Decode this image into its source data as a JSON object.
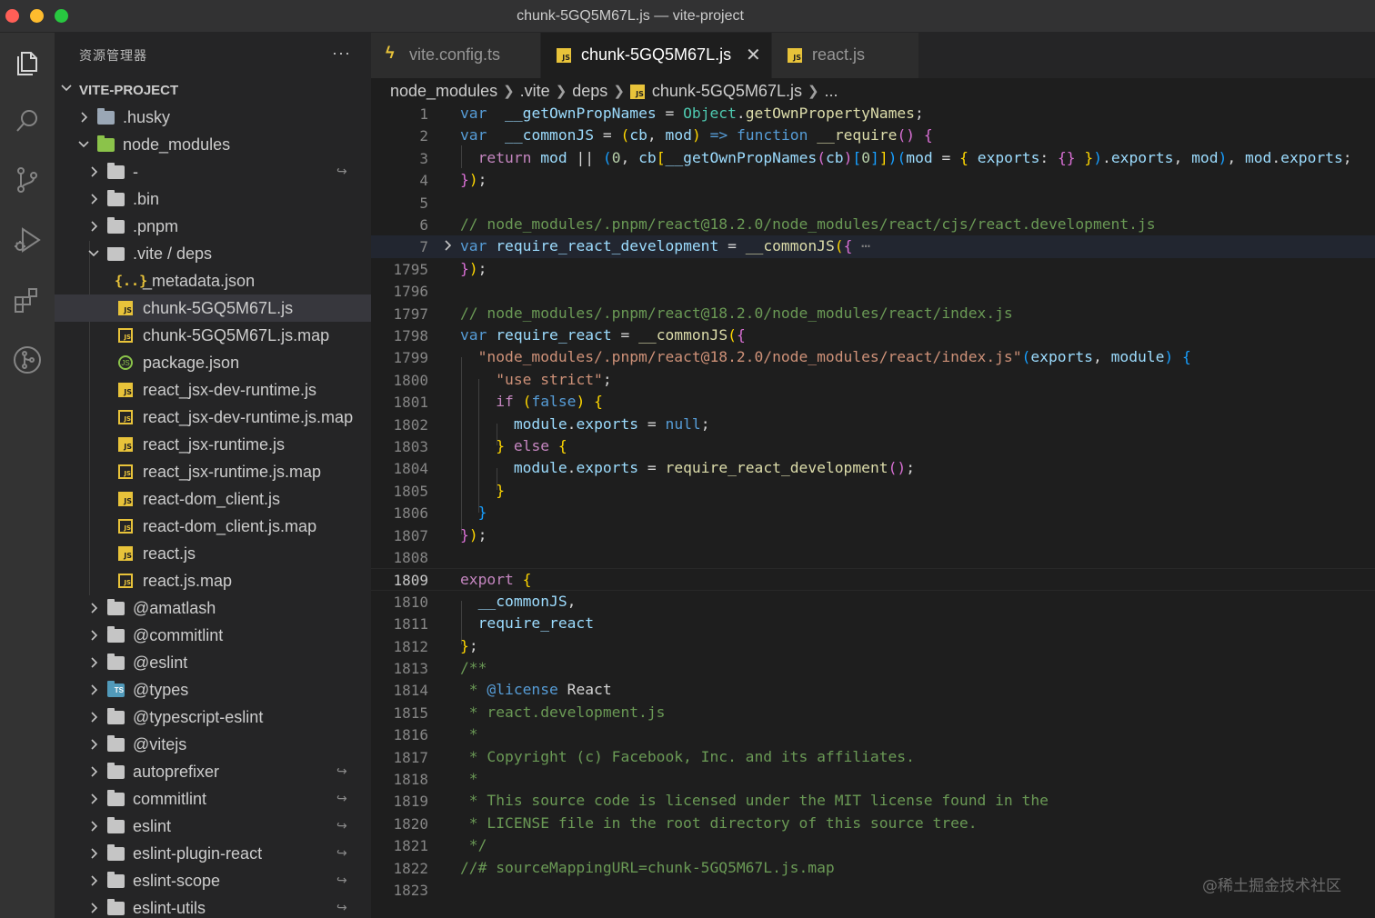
{
  "window": {
    "title": "chunk-5GQ5M67L.js — vite-project"
  },
  "activity_bar": [
    "files-icon",
    "search-icon",
    "source-control-icon",
    "run-debug-icon",
    "extensions-icon",
    "git-graph-icon"
  ],
  "sidebar": {
    "header": "资源管理器",
    "more": "···",
    "project": "VITE-PROJECT",
    "items": [
      {
        "name": ".husky",
        "depth": 1,
        "type": "folder-husky",
        "chevron": "right"
      },
      {
        "name": "node_modules",
        "depth": 1,
        "type": "folder-green",
        "chevron": "down"
      },
      {
        "name": "-",
        "depth": 2,
        "type": "folder",
        "chevron": "right",
        "link": true
      },
      {
        "name": ".bin",
        "depth": 2,
        "type": "folder",
        "chevron": "right"
      },
      {
        "name": ".pnpm",
        "depth": 2,
        "type": "folder",
        "chevron": "right"
      },
      {
        "name": ".vite / deps",
        "depth": 2,
        "type": "folder-open",
        "chevron": "down"
      },
      {
        "name": "_metadata.json",
        "depth": 3,
        "type": "json"
      },
      {
        "name": "chunk-5GQ5M67L.js",
        "depth": 3,
        "type": "js",
        "selected": true
      },
      {
        "name": "chunk-5GQ5M67L.js.map",
        "depth": 3,
        "type": "map"
      },
      {
        "name": "package.json",
        "depth": 3,
        "type": "pkg"
      },
      {
        "name": "react_jsx-dev-runtime.js",
        "depth": 3,
        "type": "js"
      },
      {
        "name": "react_jsx-dev-runtime.js.map",
        "depth": 3,
        "type": "map"
      },
      {
        "name": "react_jsx-runtime.js",
        "depth": 3,
        "type": "js"
      },
      {
        "name": "react_jsx-runtime.js.map",
        "depth": 3,
        "type": "map"
      },
      {
        "name": "react-dom_client.js",
        "depth": 3,
        "type": "js"
      },
      {
        "name": "react-dom_client.js.map",
        "depth": 3,
        "type": "map"
      },
      {
        "name": "react.js",
        "depth": 3,
        "type": "js"
      },
      {
        "name": "react.js.map",
        "depth": 3,
        "type": "map"
      },
      {
        "name": "@amatlash",
        "depth": 2,
        "type": "folder",
        "chevron": "right"
      },
      {
        "name": "@commitlint",
        "depth": 2,
        "type": "folder",
        "chevron": "right"
      },
      {
        "name": "@eslint",
        "depth": 2,
        "type": "folder",
        "chevron": "right"
      },
      {
        "name": "@types",
        "depth": 2,
        "type": "folder-ts",
        "chevron": "right"
      },
      {
        "name": "@typescript-eslint",
        "depth": 2,
        "type": "folder",
        "chevron": "right"
      },
      {
        "name": "@vitejs",
        "depth": 2,
        "type": "folder",
        "chevron": "right"
      },
      {
        "name": "autoprefixer",
        "depth": 2,
        "type": "folder",
        "chevron": "right",
        "link": true
      },
      {
        "name": "commitlint",
        "depth": 2,
        "type": "folder",
        "chevron": "right",
        "link": true
      },
      {
        "name": "eslint",
        "depth": 2,
        "type": "folder",
        "chevron": "right",
        "link": true
      },
      {
        "name": "eslint-plugin-react",
        "depth": 2,
        "type": "folder",
        "chevron": "right",
        "link": true
      },
      {
        "name": "eslint-scope",
        "depth": 2,
        "type": "folder",
        "chevron": "right",
        "link": true
      },
      {
        "name": "eslint-utils",
        "depth": 2,
        "type": "folder",
        "chevron": "right",
        "link": true
      }
    ],
    "link_glyph": "↪"
  },
  "tabs": [
    {
      "label": "vite.config.ts",
      "icon": "bolt-icon",
      "active": false
    },
    {
      "label": "chunk-5GQ5M67L.js",
      "icon": "js-file-icon",
      "active": true,
      "close": "✕"
    },
    {
      "label": "react.js",
      "icon": "js-file-icon",
      "active": false
    }
  ],
  "breadcrumb": [
    "node_modules",
    ".vite",
    "deps",
    "chunk-5GQ5M67L.js",
    "..."
  ],
  "editor": {
    "current_line": "1809",
    "lines": [
      {
        "n": "1",
        "segs": [
          [
            "kw",
            "var"
          ],
          [
            "",
            "  "
          ],
          [
            "var",
            "__getOwnPropNames"
          ],
          [
            "",
            " = "
          ],
          [
            "cls",
            "Object"
          ],
          [
            "",
            "."
          ],
          [
            "fn",
            "getOwnPropertyNames"
          ],
          [
            "",
            ";"
          ]
        ]
      },
      {
        "n": "2",
        "segs": [
          [
            "kw",
            "var"
          ],
          [
            "",
            "  "
          ],
          [
            "var",
            "__commonJS"
          ],
          [
            "",
            " = "
          ],
          [
            "b1",
            "("
          ],
          [
            "var",
            "cb"
          ],
          [
            "",
            ", "
          ],
          [
            "var",
            "mod"
          ],
          [
            "b1",
            ")"
          ],
          [
            "",
            " "
          ],
          [
            "kw",
            "=>"
          ],
          [
            "",
            " "
          ],
          [
            "kw",
            "function"
          ],
          [
            "",
            " "
          ],
          [
            "fn",
            "__require"
          ],
          [
            "b2",
            "()"
          ],
          [
            "",
            " "
          ],
          [
            "b2",
            "{"
          ]
        ]
      },
      {
        "n": "3",
        "segs": [
          [
            "",
            "  "
          ],
          [
            "kw2",
            "return"
          ],
          [
            "",
            " "
          ],
          [
            "var",
            "mod"
          ],
          [
            "",
            " || "
          ],
          [
            "b3",
            "("
          ],
          [
            "num",
            "0"
          ],
          [
            "",
            ", "
          ],
          [
            "var",
            "cb"
          ],
          [
            "b1",
            "["
          ],
          [
            "var",
            "__getOwnPropNames"
          ],
          [
            "b2",
            "("
          ],
          [
            "var",
            "cb"
          ],
          [
            "b2",
            ")"
          ],
          [
            "b3",
            "["
          ],
          [
            "num",
            "0"
          ],
          [
            "b3",
            "]"
          ],
          [
            "b1",
            "]"
          ],
          [
            "b3",
            ")"
          ],
          [
            "b3",
            "("
          ],
          [
            "var",
            "mod"
          ],
          [
            "",
            " = "
          ],
          [
            "b1",
            "{"
          ],
          [
            "",
            " "
          ],
          [
            "var",
            "exports"
          ],
          [
            "",
            ": "
          ],
          [
            "b2",
            "{}"
          ],
          [
            "",
            " "
          ],
          [
            "b1",
            "}"
          ],
          [
            "b3",
            ")"
          ],
          [
            "",
            "."
          ],
          [
            "var",
            "exports"
          ],
          [
            "",
            ", "
          ],
          [
            "var",
            "mod"
          ],
          [
            "b3",
            ")"
          ],
          [
            "",
            ", "
          ],
          [
            "var",
            "mod"
          ],
          [
            "",
            "."
          ],
          [
            "var",
            "exports"
          ],
          [
            "",
            ";"
          ]
        ]
      },
      {
        "n": "4",
        "segs": [
          [
            "b2",
            "}"
          ],
          [
            "b1",
            ")"
          ],
          [
            "",
            ";"
          ]
        ]
      },
      {
        "n": "5",
        "segs": []
      },
      {
        "n": "6",
        "segs": [
          [
            "cm",
            "// node_modules/.pnpm/react@18.2.0/node_modules/react/cjs/react.development.js"
          ]
        ]
      },
      {
        "n": "7",
        "fold": true,
        "hl": true,
        "segs": [
          [
            "kw",
            "var"
          ],
          [
            "",
            " "
          ],
          [
            "var",
            "require_react_development"
          ],
          [
            "",
            " = "
          ],
          [
            "fn",
            "__commonJS"
          ],
          [
            "b1",
            "("
          ],
          [
            "b2",
            "{"
          ],
          [
            "dim",
            " ⋯"
          ]
        ]
      },
      {
        "n": "1795",
        "segs": [
          [
            "b2",
            "}"
          ],
          [
            "b1",
            ")"
          ],
          [
            "",
            ";"
          ]
        ]
      },
      {
        "n": "1796",
        "segs": []
      },
      {
        "n": "1797",
        "segs": [
          [
            "cm",
            "// node_modules/.pnpm/react@18.2.0/node_modules/react/index.js"
          ]
        ]
      },
      {
        "n": "1798",
        "segs": [
          [
            "kw",
            "var"
          ],
          [
            "",
            " "
          ],
          [
            "var",
            "require_react"
          ],
          [
            "",
            " = "
          ],
          [
            "fn",
            "__commonJS"
          ],
          [
            "b1",
            "("
          ],
          [
            "b2",
            "{"
          ]
        ]
      },
      {
        "n": "1799",
        "segs": [
          [
            "",
            "  "
          ],
          [
            "str",
            "\"node_modules/.pnpm/react@18.2.0/node_modules/react/index.js\""
          ],
          [
            "b3",
            "("
          ],
          [
            "var",
            "exports"
          ],
          [
            "",
            ", "
          ],
          [
            "var",
            "module"
          ],
          [
            "b3",
            ")"
          ],
          [
            "",
            " "
          ],
          [
            "b3",
            "{"
          ]
        ]
      },
      {
        "n": "1800",
        "segs": [
          [
            "",
            "    "
          ],
          [
            "str",
            "\"use strict\""
          ],
          [
            "",
            ";"
          ]
        ]
      },
      {
        "n": "1801",
        "segs": [
          [
            "",
            "    "
          ],
          [
            "kw2",
            "if"
          ],
          [
            "",
            " "
          ],
          [
            "b1",
            "("
          ],
          [
            "kw",
            "false"
          ],
          [
            "b1",
            ")"
          ],
          [
            "",
            " "
          ],
          [
            "b1",
            "{"
          ]
        ]
      },
      {
        "n": "1802",
        "segs": [
          [
            "",
            "      "
          ],
          [
            "var",
            "module"
          ],
          [
            "",
            "."
          ],
          [
            "var",
            "exports"
          ],
          [
            "",
            " = "
          ],
          [
            "kw",
            "null"
          ],
          [
            "",
            ";"
          ]
        ]
      },
      {
        "n": "1803",
        "segs": [
          [
            "",
            "    "
          ],
          [
            "b1",
            "}"
          ],
          [
            "",
            " "
          ],
          [
            "kw2",
            "else"
          ],
          [
            "",
            " "
          ],
          [
            "b1",
            "{"
          ]
        ]
      },
      {
        "n": "1804",
        "segs": [
          [
            "",
            "      "
          ],
          [
            "var",
            "module"
          ],
          [
            "",
            "."
          ],
          [
            "var",
            "exports"
          ],
          [
            "",
            " = "
          ],
          [
            "fn",
            "require_react_development"
          ],
          [
            "b2",
            "()"
          ],
          [
            "",
            ";"
          ]
        ]
      },
      {
        "n": "1805",
        "segs": [
          [
            "",
            "    "
          ],
          [
            "b1",
            "}"
          ]
        ]
      },
      {
        "n": "1806",
        "segs": [
          [
            "",
            "  "
          ],
          [
            "b3",
            "}"
          ]
        ]
      },
      {
        "n": "1807",
        "segs": [
          [
            "b2",
            "}"
          ],
          [
            "b1",
            ")"
          ],
          [
            "",
            ";"
          ]
        ]
      },
      {
        "n": "1808",
        "segs": []
      },
      {
        "n": "1809",
        "segs": [
          [
            "kw2",
            "export"
          ],
          [
            "",
            " "
          ],
          [
            "b1",
            "{"
          ]
        ]
      },
      {
        "n": "1810",
        "segs": [
          [
            "",
            "  "
          ],
          [
            "var",
            "__commonJS"
          ],
          [
            "",
            ","
          ]
        ]
      },
      {
        "n": "1811",
        "segs": [
          [
            "",
            "  "
          ],
          [
            "var",
            "require_react"
          ]
        ]
      },
      {
        "n": "1812",
        "segs": [
          [
            "b1",
            "}"
          ],
          [
            "",
            ";"
          ]
        ]
      },
      {
        "n": "1813",
        "segs": [
          [
            "cm",
            "/**"
          ]
        ]
      },
      {
        "n": "1814",
        "segs": [
          [
            "cm",
            " * "
          ],
          [
            "kw",
            "@license"
          ],
          [
            "",
            " React"
          ]
        ]
      },
      {
        "n": "1815",
        "segs": [
          [
            "cm",
            " * react.development.js"
          ]
        ]
      },
      {
        "n": "1816",
        "segs": [
          [
            "cm",
            " *"
          ]
        ]
      },
      {
        "n": "1817",
        "segs": [
          [
            "cm",
            " * Copyright (c) Facebook, Inc. and its affiliates."
          ]
        ]
      },
      {
        "n": "1818",
        "segs": [
          [
            "cm",
            " *"
          ]
        ]
      },
      {
        "n": "1819",
        "segs": [
          [
            "cm",
            " * This source code is licensed under the MIT license found in the"
          ]
        ]
      },
      {
        "n": "1820",
        "segs": [
          [
            "cm",
            " * LICENSE file in the root directory of this source tree."
          ]
        ]
      },
      {
        "n": "1821",
        "segs": [
          [
            "cm",
            " */"
          ]
        ]
      },
      {
        "n": "1822",
        "segs": [
          [
            "cm",
            "//# sourceMappingURL=chunk-5GQ5M67L.js.map"
          ]
        ]
      },
      {
        "n": "1823",
        "segs": []
      }
    ]
  },
  "watermark": "@稀土掘金技术社区"
}
